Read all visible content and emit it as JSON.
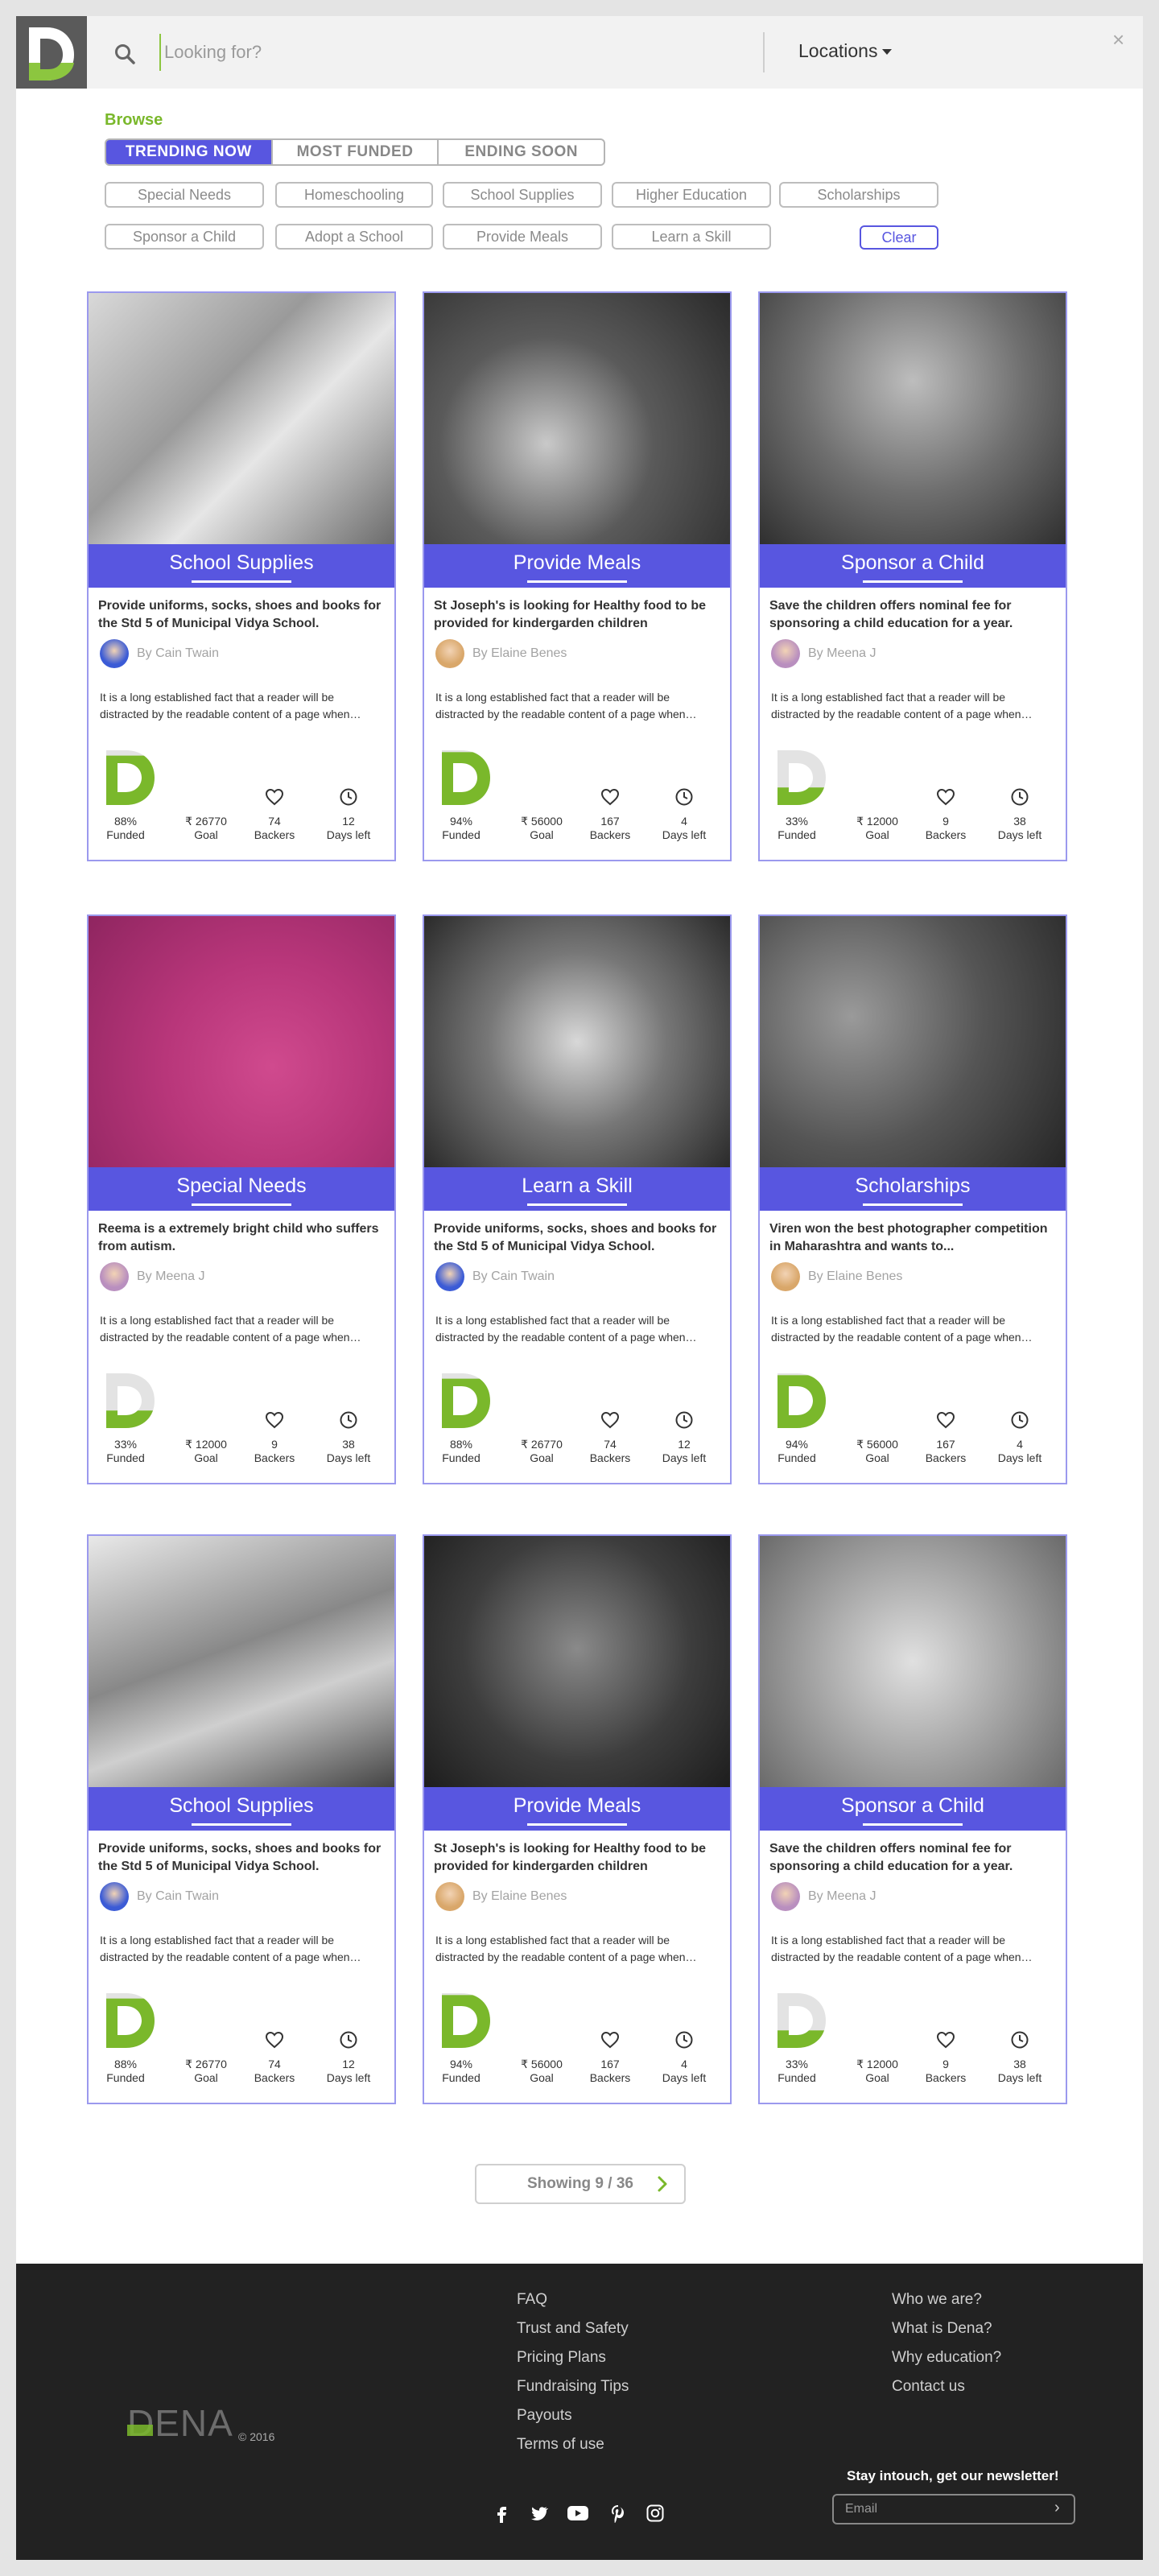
{
  "header": {
    "logo_letter": "D",
    "search_placeholder": "Looking for?",
    "locations_label": "Locations",
    "close_label": "×"
  },
  "browse": {
    "label": "Browse",
    "tabs": [
      "TRENDING NOW",
      "MOST FUNDED",
      "ENDING SOON"
    ],
    "active_tab": "TRENDING NOW",
    "chips_row1": [
      "Special Needs",
      "Homeschooling",
      "School Supplies",
      "Higher Education",
      "Scholarships"
    ],
    "chips_row2": [
      "Sponsor a Child",
      "Adopt a School",
      "Provide Meals",
      "Learn a Skill"
    ],
    "clear_label": "Clear"
  },
  "stat_labels": {
    "funded": "Funded",
    "goal": "Goal",
    "backers": "Backers",
    "days": "Days left"
  },
  "cards": [
    {
      "category": "School Supplies",
      "title": "Provide uniforms, socks, shoes and books for the Std 5 of Municipal Vidya School.",
      "author": "By Cain Twain",
      "description": "It is a long established fact that a reader will be distracted by the readable content of a page when…",
      "funded_pct": "88%",
      "funded_fraction": 0.88,
      "goal": "₹ 26770",
      "backers": "74",
      "days_left": "12"
    },
    {
      "category": "Provide Meals",
      "title": "St Joseph's is looking for Healthy food to be provided for kindergarden children",
      "author": "By Elaine Benes",
      "description": "It is a long established fact that a reader will be distracted by the readable content of a page when…",
      "funded_pct": "94%",
      "funded_fraction": 0.94,
      "goal": "₹ 56000",
      "backers": "167",
      "days_left": "4"
    },
    {
      "category": "Sponsor a Child",
      "title": "Save the children offers nominal fee for sponsoring a child education for a year.",
      "author": "By Meena J",
      "description": "It is a long established fact that a reader will be distracted by the readable content of a page when…",
      "funded_pct": "33%",
      "funded_fraction": 0.33,
      "goal": "₹ 12000",
      "backers": "9",
      "days_left": "38"
    },
    {
      "category": "Special Needs",
      "title": "Reema is a extremely bright child who suffers from autism.",
      "author": "By Meena J",
      "description": "It is a long established fact that a reader will be distracted by the readable content of a page when…",
      "funded_pct": "33%",
      "funded_fraction": 0.33,
      "goal": "₹ 12000",
      "backers": "9",
      "days_left": "38"
    },
    {
      "category": "Learn a Skill",
      "title": "Provide uniforms, socks, shoes and books for the Std 5 of Municipal Vidya School.",
      "author": "By Cain Twain",
      "description": "It is a long established fact that a reader will be distracted by the readable content of a page when…",
      "funded_pct": "88%",
      "funded_fraction": 0.88,
      "goal": "₹ 26770",
      "backers": "74",
      "days_left": "12"
    },
    {
      "category": "Scholarships",
      "title": "Viren won the best photographer competition in Maharashtra and wants to...",
      "author": "By Elaine Benes",
      "description": "It is a long established fact that a reader will be distracted by the readable content of a page when…",
      "funded_pct": "94%",
      "funded_fraction": 0.94,
      "goal": "₹ 56000",
      "backers": "167",
      "days_left": "4"
    },
    {
      "category": "School Supplies",
      "title": "Provide uniforms, socks, shoes and books for the Std 5 of Municipal Vidya School.",
      "author": "By Cain Twain",
      "description": "It is a long established fact that a reader will be distracted by the readable content of a page when…",
      "funded_pct": "88%",
      "funded_fraction": 0.88,
      "goal": "₹ 26770",
      "backers": "74",
      "days_left": "12"
    },
    {
      "category": "Provide Meals",
      "title": "St Joseph's is looking for Healthy food to be provided for kindergarden children",
      "author": "By Elaine Benes",
      "description": "It is a long established fact that a reader will be distracted by the readable content of a page when…",
      "funded_pct": "94%",
      "funded_fraction": 0.94,
      "goal": "₹ 56000",
      "backers": "167",
      "days_left": "4"
    },
    {
      "category": "Sponsor a Child",
      "title": "Save the children offers nominal fee for sponsoring a child education for a year.",
      "author": "By Meena J",
      "description": "It is a long established fact that a reader will be distracted by the readable content of a page when…",
      "funded_pct": "33%",
      "funded_fraction": 0.33,
      "goal": "₹ 12000",
      "backers": "9",
      "days_left": "38"
    }
  ],
  "pager": {
    "label": "Showing 9 / 36"
  },
  "footer": {
    "brand": "DENA",
    "copyright": "© 2016",
    "col1": [
      "FAQ",
      "Trust and Safety",
      "Pricing Plans",
      "Fundraising Tips",
      "Payouts",
      "Terms of use"
    ],
    "col2": [
      "Who we are?",
      "What is Dena?",
      "Why education?",
      "Contact us"
    ],
    "social_icons": [
      "facebook-icon",
      "twitter-icon",
      "youtube-icon",
      "pinterest-icon",
      "instagram-icon"
    ],
    "newsletter_label": "Stay intouch, get our newsletter!",
    "email_placeholder": "Email",
    "submit_label": "›"
  },
  "colors": {
    "accent": "#5856e0",
    "brand_green": "#7ab82b",
    "footer_bg": "#222222"
  }
}
